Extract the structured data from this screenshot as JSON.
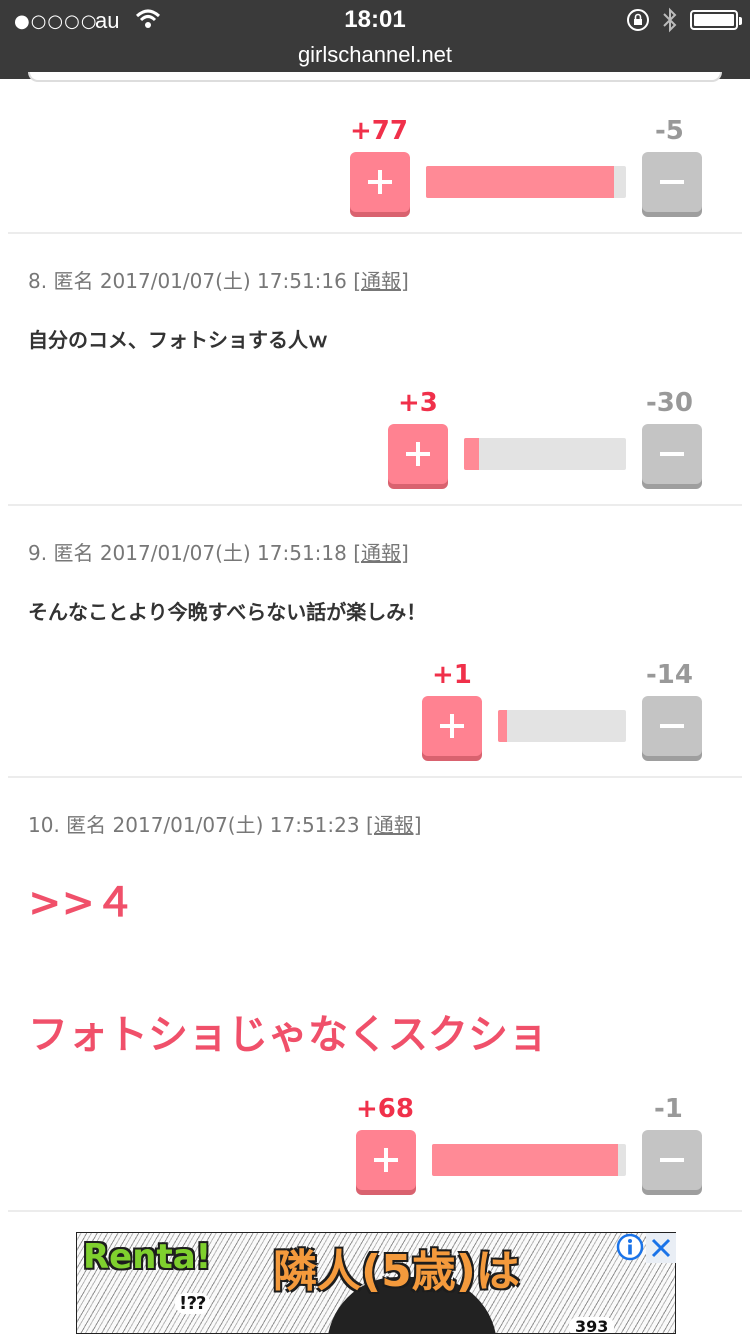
{
  "status_bar": {
    "signal": "●○○○○",
    "carrier": "au",
    "time": "18:01",
    "url": "girlschannel.net"
  },
  "top_vote": {
    "plus": "+77",
    "minus": "-5",
    "ratio": 0.94
  },
  "comments": [
    {
      "number": "8.",
      "author": "匿名",
      "datetime": "2017/01/07(土) 17:51:16",
      "report": "[通報]",
      "text": "自分のコメ、フォトショする人ｗ",
      "plus": "+3",
      "minus": "-30",
      "ratio": 0.09
    },
    {
      "number": "9.",
      "author": "匿名",
      "datetime": "2017/01/07(土) 17:51:18",
      "report": "[通報]",
      "text": "そんなことより今晩すべらない話が楽しみ！",
      "plus": "+1",
      "minus": "-14",
      "ratio": 0.07
    },
    {
      "number": "10.",
      "author": "匿名",
      "datetime": "2017/01/07(土) 17:51:23",
      "report": "[通報]",
      "text_line1": ">>４",
      "text_line2": "フォトショじゃなくスクショ",
      "plus": "+68",
      "minus": "-1",
      "ratio": 0.96
    }
  ],
  "ad": {
    "brand": "Renta!",
    "headline": "隣人(5歳)は",
    "bubble": "!⁇",
    "small": "393"
  },
  "colors": {
    "plus": "#f0304a",
    "plus_button": "#ff8291",
    "minus_button": "#c4c4c4",
    "pink_text": "#f0506a"
  }
}
